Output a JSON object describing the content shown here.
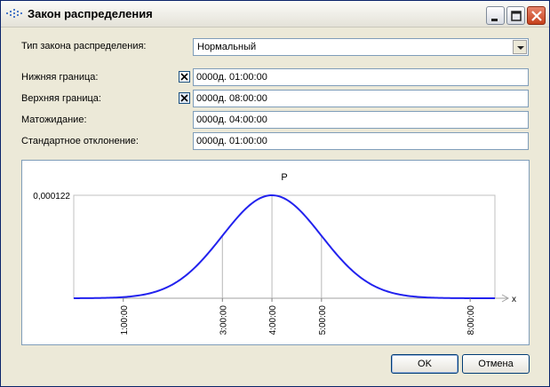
{
  "window": {
    "title": "Закон распределения",
    "controls": {
      "minimize": "minimize-icon",
      "maximize": "maximize-icon",
      "close": "close-icon"
    }
  },
  "form": {
    "distribution_type": {
      "label": "Тип закона распределения:",
      "value": "Нормальный"
    },
    "lower_bound": {
      "label": "Нижняя граница:",
      "checked": true,
      "value": "0000д. 01:00:00"
    },
    "upper_bound": {
      "label": "Верхняя граница:",
      "checked": true,
      "value": "0000д. 08:00:00"
    },
    "expectation": {
      "label": "Матожидание:",
      "value": "0000д. 04:00:00"
    },
    "std_deviation": {
      "label": "Стандартное отклонение:",
      "value": "0000д. 01:00:00"
    }
  },
  "chart_data": {
    "type": "line",
    "title": "P",
    "xlabel": "x",
    "ylabel": "",
    "y_tick_label": "0,000122",
    "x_tick_labels": [
      "1:00:00",
      "3:00:00",
      "4:00:00",
      "5:00:00",
      "8:00:00"
    ],
    "x_ticks_hours": [
      1,
      3,
      4,
      5,
      8
    ],
    "xlim_hours": [
      0,
      8.5
    ],
    "mean_hours": 4,
    "std_hours": 1,
    "grid": true,
    "series": [
      {
        "color": "#2222ee",
        "distribution": "normal",
        "mean_hours": 4,
        "std_hours": 1
      }
    ]
  },
  "buttons": {
    "ok": "OK",
    "cancel": "Отмена"
  }
}
